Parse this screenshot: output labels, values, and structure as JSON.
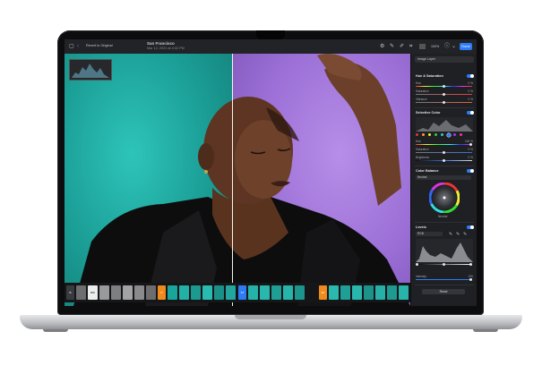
{
  "toolbar": {
    "revert_label": "Revert to Original",
    "title": "San Francisco",
    "subtitle": "Mar 12, 2021 at 4:02 PM",
    "zoom": "100%",
    "done_label": "Done"
  },
  "sidebar": {
    "layer_select": "Image Layer",
    "sections": {
      "hue_saturation": {
        "title": "Hue & Saturation",
        "toggle_on": true,
        "rows": [
          {
            "label": "Hue",
            "value": "0 %",
            "fraction": 0.5
          },
          {
            "label": "Saturation",
            "value": "0 %",
            "fraction": 0.5
          },
          {
            "label": "Vibrance",
            "value": "0 %",
            "fraction": 0.5
          }
        ]
      },
      "selective_color": {
        "title": "Selective Color",
        "toggle_on": true,
        "rows": [
          {
            "label": "Hue",
            "value": "100 %",
            "fraction": 0.98
          },
          {
            "label": "Saturation",
            "value": "0 %",
            "fraction": 0.5
          },
          {
            "label": "Brightness",
            "value": "0 %",
            "fraction": 0.5
          }
        ]
      },
      "color_balance": {
        "title": "Color Balance",
        "toggle_on": true,
        "mode": "Neutral",
        "wheel_label": "Neutral"
      },
      "levels": {
        "title": "Levels",
        "toggle_on": true,
        "channel": "RGB",
        "intensity_label": "Intensity",
        "intensity_value": "100",
        "reset_label": "Reset"
      }
    }
  },
  "filmstrip": {
    "labels": [
      "B",
      "BW",
      "P",
      "ST",
      "SP"
    ]
  },
  "colors": {
    "accent": "#2d7cf6",
    "teal": "#1fb3aa",
    "purple": "#9b6fd6",
    "orange_tag": "#f08a1c"
  }
}
